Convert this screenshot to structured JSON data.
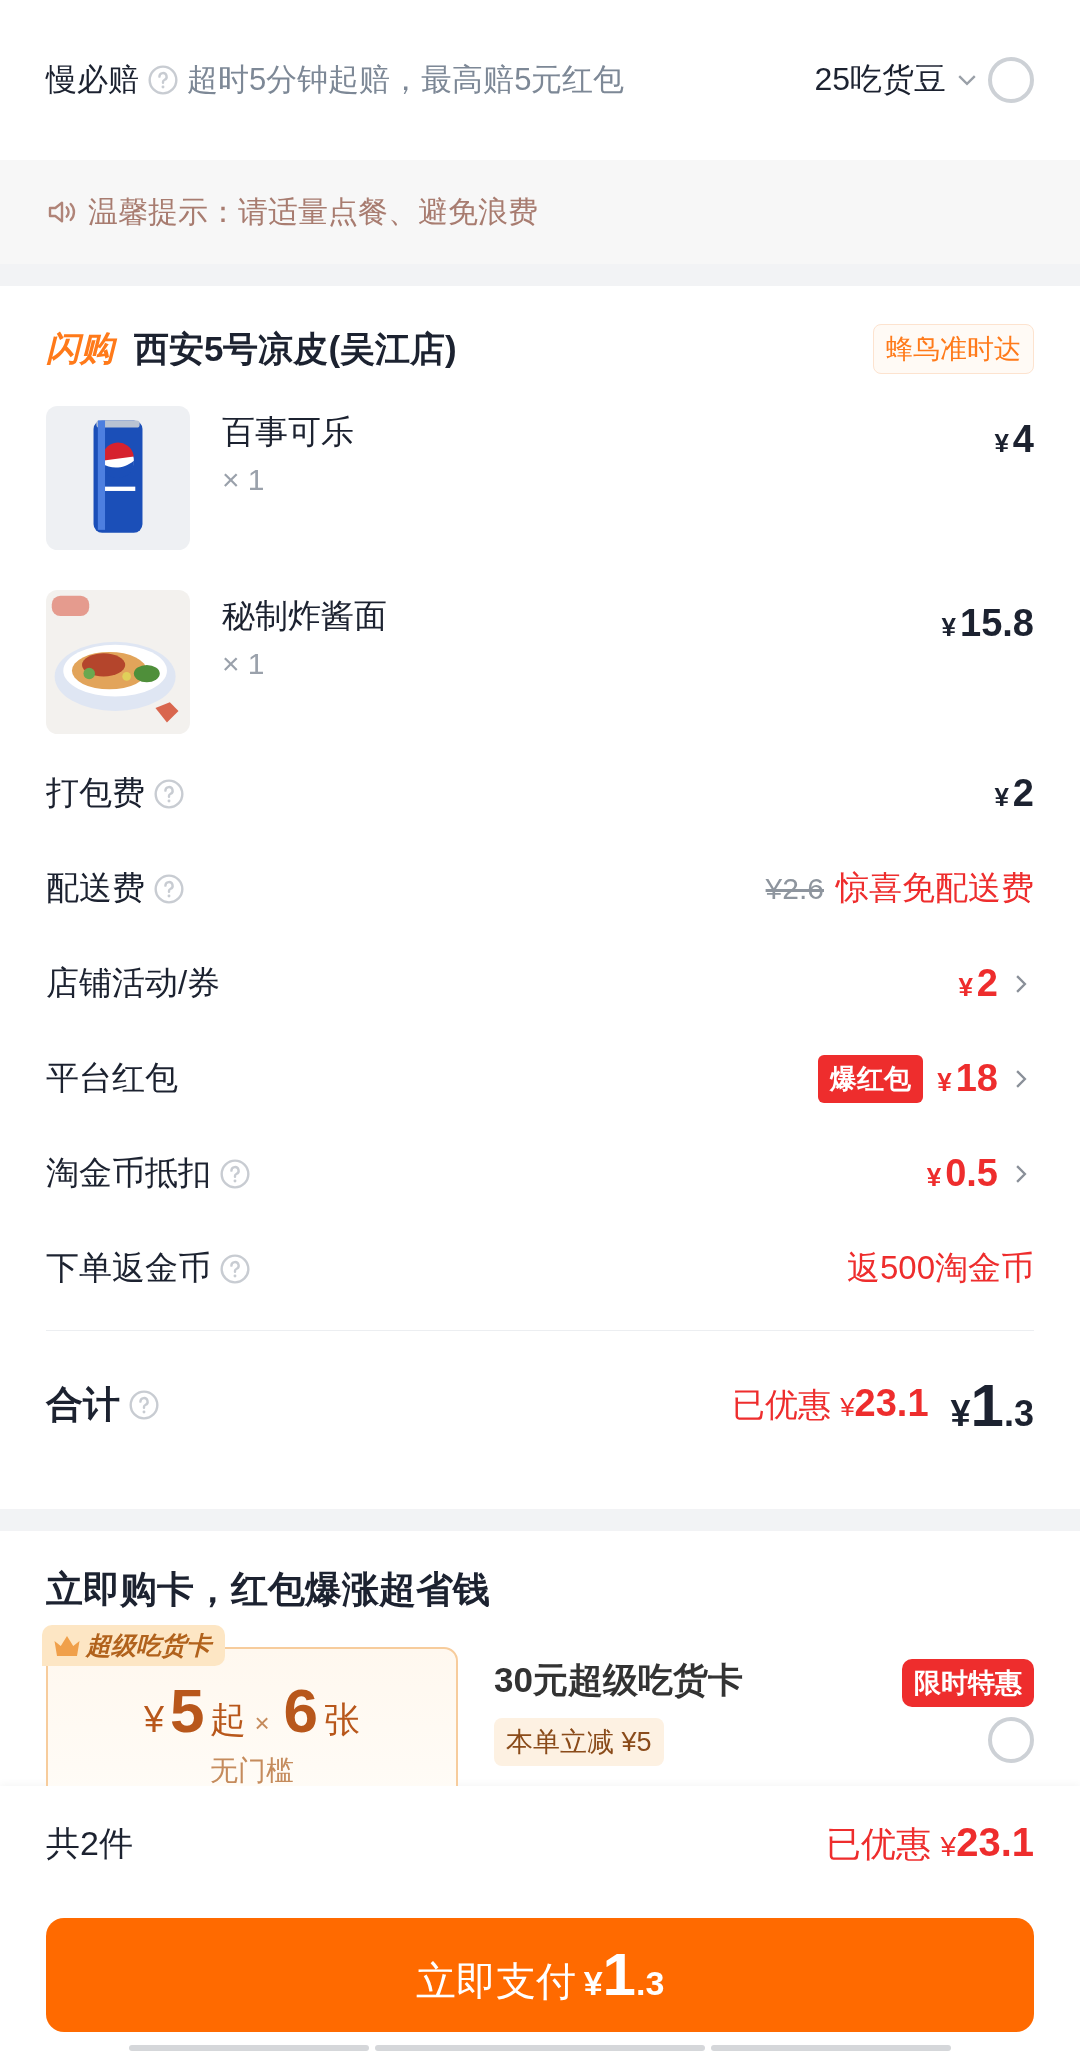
{
  "slow_compensation": {
    "label": "慢必赔",
    "help": true,
    "description": "超时5分钟起赔，最高赔5元红包",
    "points": "25吃货豆",
    "selected": false
  },
  "tip": {
    "text": "温馨提示：请适量点餐、避免浪费"
  },
  "shop": {
    "badge": "闪购",
    "name": "西安5号凉皮(吴江店)",
    "tag": "蜂鸟准时达"
  },
  "items": [
    {
      "kind": "can",
      "name": "百事可乐",
      "quantity": "× 1",
      "currency": "¥",
      "price": "4"
    },
    {
      "kind": "bowl",
      "name": "秘制炸酱面",
      "quantity": "× 1",
      "currency": "¥",
      "price": "15.8"
    }
  ],
  "fees": [
    {
      "kind": "amount",
      "label": "打包费",
      "help": true,
      "currency": "¥",
      "value": "2",
      "chevron": false
    },
    {
      "kind": "free",
      "label": "配送费",
      "help": true,
      "original": "¥2.6",
      "value": "惊喜免配送费",
      "chevron": false
    },
    {
      "kind": "discount",
      "label": "店铺活动/券",
      "help": false,
      "currency": "¥",
      "value": "2",
      "chevron": true
    },
    {
      "kind": "discount",
      "label": "平台红包",
      "help": false,
      "badge": "爆红包",
      "currency": "¥",
      "value": "18",
      "chevron": true
    },
    {
      "kind": "discount",
      "label": "淘金币抵扣",
      "help": true,
      "currency": "¥",
      "value": "0.5",
      "chevron": true
    },
    {
      "kind": "note",
      "label": "下单返金币",
      "help": true,
      "value": "返500淘金币",
      "chevron": false
    }
  ],
  "total": {
    "label": "合计",
    "help": true,
    "saved_label": "已优惠",
    "saved_currency": "¥",
    "saved": "23.1",
    "currency": "¥",
    "amount_int": "1",
    "amount_dec": ".3"
  },
  "card_offer": {
    "heading": "立即购卡，红包爆涨超省钱",
    "ribbon": "超级吃货卡",
    "currency": "¥",
    "price": "5",
    "from": "起",
    "times": "×",
    "count": "6",
    "unit": "张",
    "note": "无门槛",
    "title": "30元超级吃货卡",
    "discount": "本单立减 ¥5",
    "promo": "限时特惠",
    "selected": false
  },
  "footer": {
    "count": "共2件",
    "saved_label": "已优惠",
    "saved_currency": "¥",
    "saved": "23.1",
    "pay": {
      "label": "立即支付",
      "currency": "¥",
      "amount_int": "1",
      "amount_dec": ".3"
    }
  }
}
